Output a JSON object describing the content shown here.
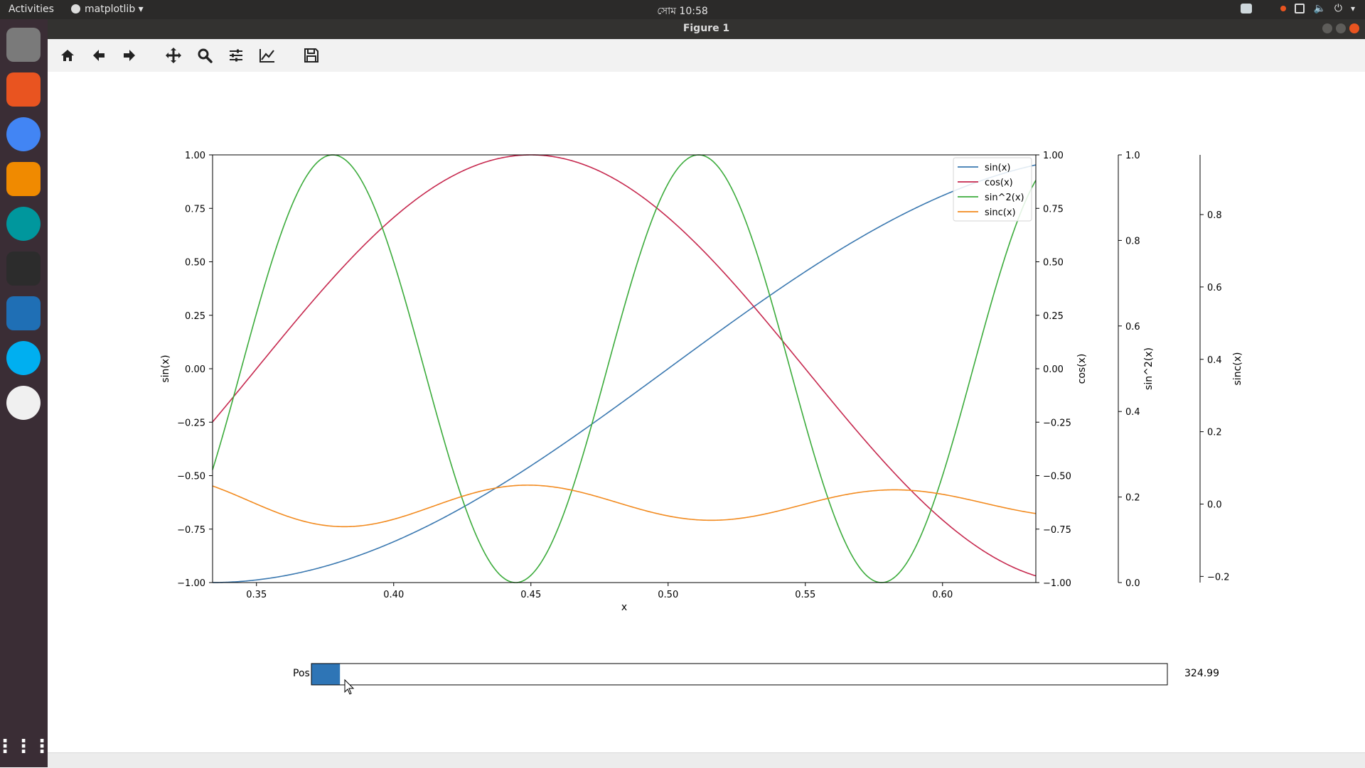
{
  "desktop": {
    "activities_label": "Activities",
    "app_menu_label": "matplotlib",
    "clock": "সোম 10:58"
  },
  "window": {
    "title": "Figure 1"
  },
  "dock": {
    "apps": [
      {
        "name": "files-icon",
        "color": "#7a7a7a"
      },
      {
        "name": "software-center-icon",
        "color": "#e95420"
      },
      {
        "name": "chrome-icon",
        "color": "#4285f4"
      },
      {
        "name": "vlc-icon",
        "color": "#f08a00"
      },
      {
        "name": "arduino-icon",
        "color": "#00979d"
      },
      {
        "name": "terminal-icon",
        "color": "#2c2c2c"
      },
      {
        "name": "vscode-icon",
        "color": "#1f6fb5"
      },
      {
        "name": "skype-icon",
        "color": "#00aff0"
      },
      {
        "name": "screenshot-tool-icon",
        "color": "#f0f0f0"
      }
    ]
  },
  "toolbar": {
    "buttons": [
      "home-icon",
      "back-icon",
      "forward-icon",
      "pan-icon",
      "zoom-icon",
      "configure-subplots-icon",
      "edit-axes-icon",
      "save-icon"
    ]
  },
  "slider": {
    "label": "Pos",
    "value_text": "324.99",
    "fill_fraction": 0.033,
    "color": "#2e75b6"
  },
  "colors": {
    "sin": "#3a78b0",
    "cos": "#c6284e",
    "sin2": "#3bab3b",
    "sinc": "#f28a1e"
  },
  "chart_data": {
    "type": "line",
    "xlabel": "x",
    "xlim": [
      0.334,
      0.634
    ],
    "x_ticks": [
      "0.35",
      "0.40",
      "0.45",
      "0.50",
      "0.55",
      "0.60"
    ],
    "x_tick_values": [
      0.35,
      0.4,
      0.45,
      0.5,
      0.55,
      0.6
    ],
    "axes": [
      {
        "label": "sin(x)",
        "lim": [
          -1.0,
          1.0
        ],
        "ticks": [
          "1.00",
          "0.75",
          "0.50",
          "0.25",
          "0.00",
          "−0.25",
          "−0.50",
          "−0.75",
          "−1.00"
        ],
        "tick_values": [
          1.0,
          0.75,
          0.5,
          0.25,
          0.0,
          -0.25,
          -0.5,
          -0.75,
          -1.0
        ]
      },
      {
        "label": "cos(x)",
        "lim": [
          -1.0,
          1.0
        ],
        "ticks": [
          "1.00",
          "0.75",
          "0.50",
          "0.25",
          "0.00",
          "−0.25",
          "−0.50",
          "−0.75",
          "−1.00"
        ],
        "tick_values": [
          1.0,
          0.75,
          0.5,
          0.25,
          0.0,
          -0.25,
          -0.5,
          -0.75,
          -1.0
        ]
      },
      {
        "label": "sin^2(x)",
        "lim": [
          0.0,
          1.0
        ],
        "ticks": [
          "1.0",
          "0.8",
          "0.6",
          "0.4",
          "0.2",
          "0.0"
        ],
        "tick_values": [
          1.0,
          0.8,
          0.6,
          0.4,
          0.2,
          0.0
        ]
      },
      {
        "label": "sinc(x)",
        "lim": [
          -0.217,
          0.965
        ],
        "ticks": [
          "0.8",
          "0.6",
          "0.4",
          "0.2",
          "0.0",
          "−0.2"
        ],
        "tick_values": [
          0.8,
          0.6,
          0.4,
          0.2,
          0.0,
          -0.2
        ]
      }
    ],
    "series": [
      {
        "name": "sin(x)",
        "type": "sin",
        "axis": 0,
        "omega": 9.42478,
        "phase": -4.71239
      },
      {
        "name": "cos(x)",
        "type": "cos",
        "axis": 1,
        "omega": 15.70796,
        "phase": -7.06858
      },
      {
        "name": "sin^2(x)",
        "type": "sin2",
        "axis": 2,
        "omega": 23.56194,
        "phase": -1.0472
      },
      {
        "name": "sinc(x)",
        "type": "sinc",
        "axis": 3,
        "omega": 47.12389,
        "phase": -19.63495,
        "offset": 17.6
      }
    ],
    "legend": {
      "placement": "top-right",
      "entries": [
        "sin(x)",
        "cos(x)",
        "sin^2(x)",
        "sinc(x)"
      ]
    },
    "grid": false
  }
}
